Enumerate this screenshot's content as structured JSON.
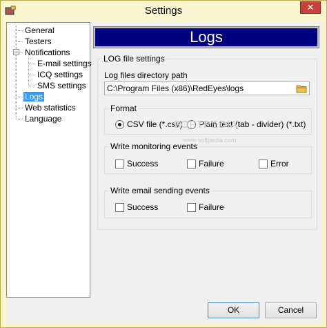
{
  "window": {
    "title": "Settings",
    "close_label": "✕"
  },
  "tree": {
    "items": [
      {
        "label": "General"
      },
      {
        "label": "Testers"
      },
      {
        "label": "Notifications",
        "expander": "−"
      },
      {
        "label": "E-mail settings"
      },
      {
        "label": "ICQ settings"
      },
      {
        "label": "SMS settings"
      },
      {
        "label": "Logs"
      },
      {
        "label": "Web statistics"
      },
      {
        "label": "Language"
      }
    ]
  },
  "panel": {
    "header": "Logs",
    "log_group": {
      "title": "LOG file settings",
      "dir_label": "Log files directory path",
      "dir_value": "C:\\Program Files (x86)\\RedEyes\\logs"
    },
    "format_group": {
      "title": "Format",
      "option_csv": "CSV file (*.csv)",
      "option_txt": "Plain text (tab - divider) (*.txt)"
    },
    "monitoring_group": {
      "title": "Write monitoring events",
      "success": "Success",
      "failure": "Failure",
      "error": "Error"
    },
    "email_group": {
      "title": "Write email sending events",
      "success": "Success",
      "failure": "Failure"
    }
  },
  "watermark": {
    "text1": "SOFTPEDIA",
    "text2": "www.softpedia.com"
  },
  "buttons": {
    "ok": "OK",
    "cancel": "Cancel"
  },
  "colors": {
    "header_bg": "#000080",
    "title_bg": "#f7f4ce",
    "selection": "#3399ff",
    "close": "#c7403a"
  }
}
